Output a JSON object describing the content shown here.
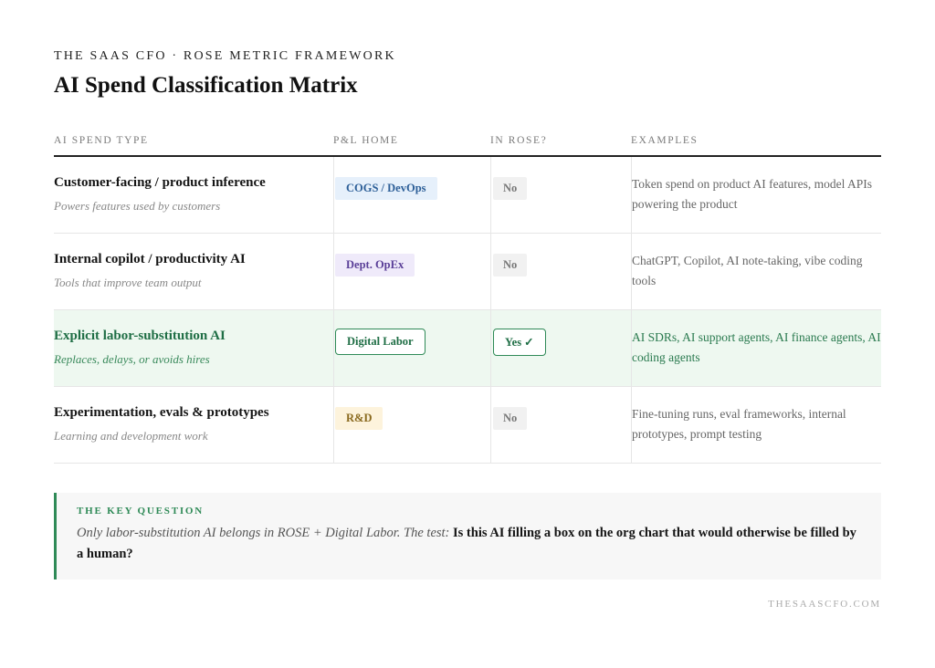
{
  "header": {
    "eyebrow": "THE SAAS CFO · ROSE METRIC FRAMEWORK",
    "title": "AI Spend Classification Matrix"
  },
  "table": {
    "columns": [
      "AI SPEND TYPE",
      "P&L HOME",
      "IN ROSE?",
      "EXAMPLES"
    ],
    "rows": [
      {
        "type": "Customer-facing / product inference",
        "subtitle": "Powers features used by customers",
        "pl_home": "COGS / DevOps",
        "in_rose": "No",
        "examples": "Token spend on product AI features, model APIs powering the product"
      },
      {
        "type": "Internal copilot / productivity AI",
        "subtitle": "Tools that improve team output",
        "pl_home": "Dept. OpEx",
        "in_rose": "No",
        "examples": "ChatGPT, Copilot, AI note-taking, vibe coding tools"
      },
      {
        "type": "Explicit labor-substitution AI",
        "subtitle": "Replaces, delays, or avoids hires",
        "pl_home": "Digital Labor",
        "in_rose": "Yes ✓",
        "examples": "AI SDRs, AI support agents, AI finance agents, AI coding agents"
      },
      {
        "type": "Experimentation, evals & prototypes",
        "subtitle": "Learning and development work",
        "pl_home": "R&D",
        "in_rose": "No",
        "examples": "Fine-tuning runs, eval frameworks, internal prototypes, prompt testing"
      }
    ]
  },
  "callout": {
    "label": "THE KEY QUESTION",
    "intro": "Only labor-substitution AI belongs in ROSE + Digital Labor. The test: ",
    "question": "Is this AI filling a box on the org chart that would otherwise be filled by a human?"
  },
  "footer": "THESAASCFO.COM",
  "colors": {
    "accent_green": "#2f8a57",
    "highlight_row": "#eef8f0",
    "cogs_badge": "#e6f0fb",
    "opex_badge": "#efeafa",
    "rd_badge": "#fdf3dc"
  }
}
